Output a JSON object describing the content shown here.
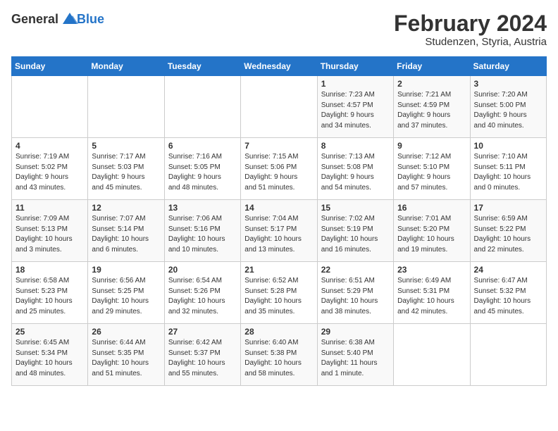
{
  "header": {
    "logo_general": "General",
    "logo_blue": "Blue",
    "month_year": "February 2024",
    "location": "Studenzen, Styria, Austria"
  },
  "days_of_week": [
    "Sunday",
    "Monday",
    "Tuesday",
    "Wednesday",
    "Thursday",
    "Friday",
    "Saturday"
  ],
  "weeks": [
    [
      {
        "day": "",
        "content": ""
      },
      {
        "day": "",
        "content": ""
      },
      {
        "day": "",
        "content": ""
      },
      {
        "day": "",
        "content": ""
      },
      {
        "day": "1",
        "content": "Sunrise: 7:23 AM\nSunset: 4:57 PM\nDaylight: 9 hours\nand 34 minutes."
      },
      {
        "day": "2",
        "content": "Sunrise: 7:21 AM\nSunset: 4:59 PM\nDaylight: 9 hours\nand 37 minutes."
      },
      {
        "day": "3",
        "content": "Sunrise: 7:20 AM\nSunset: 5:00 PM\nDaylight: 9 hours\nand 40 minutes."
      }
    ],
    [
      {
        "day": "4",
        "content": "Sunrise: 7:19 AM\nSunset: 5:02 PM\nDaylight: 9 hours\nand 43 minutes."
      },
      {
        "day": "5",
        "content": "Sunrise: 7:17 AM\nSunset: 5:03 PM\nDaylight: 9 hours\nand 45 minutes."
      },
      {
        "day": "6",
        "content": "Sunrise: 7:16 AM\nSunset: 5:05 PM\nDaylight: 9 hours\nand 48 minutes."
      },
      {
        "day": "7",
        "content": "Sunrise: 7:15 AM\nSunset: 5:06 PM\nDaylight: 9 hours\nand 51 minutes."
      },
      {
        "day": "8",
        "content": "Sunrise: 7:13 AM\nSunset: 5:08 PM\nDaylight: 9 hours\nand 54 minutes."
      },
      {
        "day": "9",
        "content": "Sunrise: 7:12 AM\nSunset: 5:10 PM\nDaylight: 9 hours\nand 57 minutes."
      },
      {
        "day": "10",
        "content": "Sunrise: 7:10 AM\nSunset: 5:11 PM\nDaylight: 10 hours\nand 0 minutes."
      }
    ],
    [
      {
        "day": "11",
        "content": "Sunrise: 7:09 AM\nSunset: 5:13 PM\nDaylight: 10 hours\nand 3 minutes."
      },
      {
        "day": "12",
        "content": "Sunrise: 7:07 AM\nSunset: 5:14 PM\nDaylight: 10 hours\nand 6 minutes."
      },
      {
        "day": "13",
        "content": "Sunrise: 7:06 AM\nSunset: 5:16 PM\nDaylight: 10 hours\nand 10 minutes."
      },
      {
        "day": "14",
        "content": "Sunrise: 7:04 AM\nSunset: 5:17 PM\nDaylight: 10 hours\nand 13 minutes."
      },
      {
        "day": "15",
        "content": "Sunrise: 7:02 AM\nSunset: 5:19 PM\nDaylight: 10 hours\nand 16 minutes."
      },
      {
        "day": "16",
        "content": "Sunrise: 7:01 AM\nSunset: 5:20 PM\nDaylight: 10 hours\nand 19 minutes."
      },
      {
        "day": "17",
        "content": "Sunrise: 6:59 AM\nSunset: 5:22 PM\nDaylight: 10 hours\nand 22 minutes."
      }
    ],
    [
      {
        "day": "18",
        "content": "Sunrise: 6:58 AM\nSunset: 5:23 PM\nDaylight: 10 hours\nand 25 minutes."
      },
      {
        "day": "19",
        "content": "Sunrise: 6:56 AM\nSunset: 5:25 PM\nDaylight: 10 hours\nand 29 minutes."
      },
      {
        "day": "20",
        "content": "Sunrise: 6:54 AM\nSunset: 5:26 PM\nDaylight: 10 hours\nand 32 minutes."
      },
      {
        "day": "21",
        "content": "Sunrise: 6:52 AM\nSunset: 5:28 PM\nDaylight: 10 hours\nand 35 minutes."
      },
      {
        "day": "22",
        "content": "Sunrise: 6:51 AM\nSunset: 5:29 PM\nDaylight: 10 hours\nand 38 minutes."
      },
      {
        "day": "23",
        "content": "Sunrise: 6:49 AM\nSunset: 5:31 PM\nDaylight: 10 hours\nand 42 minutes."
      },
      {
        "day": "24",
        "content": "Sunrise: 6:47 AM\nSunset: 5:32 PM\nDaylight: 10 hours\nand 45 minutes."
      }
    ],
    [
      {
        "day": "25",
        "content": "Sunrise: 6:45 AM\nSunset: 5:34 PM\nDaylight: 10 hours\nand 48 minutes."
      },
      {
        "day": "26",
        "content": "Sunrise: 6:44 AM\nSunset: 5:35 PM\nDaylight: 10 hours\nand 51 minutes."
      },
      {
        "day": "27",
        "content": "Sunrise: 6:42 AM\nSunset: 5:37 PM\nDaylight: 10 hours\nand 55 minutes."
      },
      {
        "day": "28",
        "content": "Sunrise: 6:40 AM\nSunset: 5:38 PM\nDaylight: 10 hours\nand 58 minutes."
      },
      {
        "day": "29",
        "content": "Sunrise: 6:38 AM\nSunset: 5:40 PM\nDaylight: 11 hours\nand 1 minute."
      },
      {
        "day": "",
        "content": ""
      },
      {
        "day": "",
        "content": ""
      }
    ]
  ]
}
